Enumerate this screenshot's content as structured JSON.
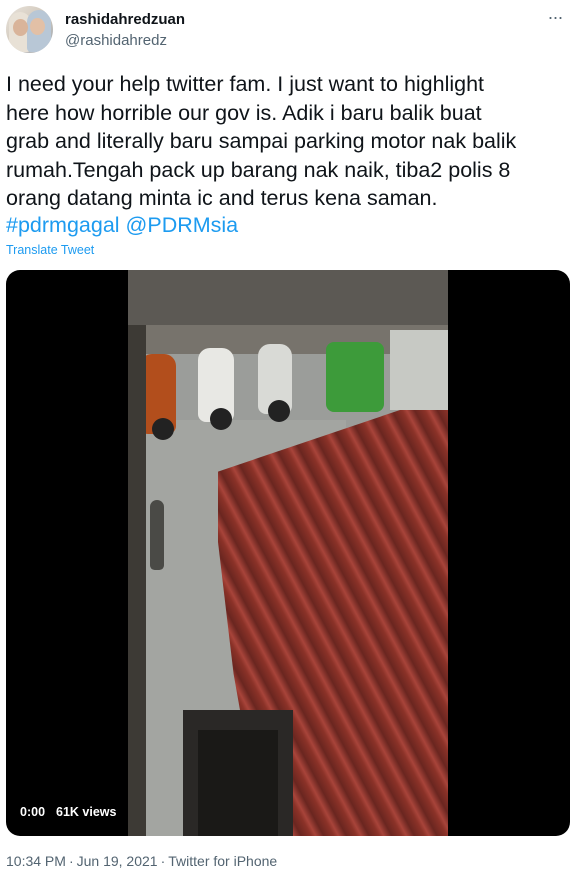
{
  "author": {
    "display_name": "rashidahredzuan",
    "handle": "@rashidahredz"
  },
  "more_menu_glyph": "···",
  "tweet": {
    "text": "I need your help twitter fam. I just want to highlight\nhere how horrible our gov is. Adik i baru balik buat\ngrab and literally baru sampai parking motor nak balik\nrumah.Tengah pack up barang nak naik, tiba2 polis 8\norang datang minta ic and terus kena saman.",
    "hashtag": "#pdrmgagal",
    "mention": "@PDRMsia",
    "translate_label": "Translate Tweet"
  },
  "video": {
    "time": "0:00",
    "views": "61K views"
  },
  "footer": {
    "time": "10:34 PM",
    "date": "Jun 19, 2021",
    "source": "Twitter for iPhone",
    "separator": "·"
  },
  "colors": {
    "link": "#1d9bf0",
    "text": "#0f1419",
    "secondary": "#536471"
  },
  "icons": {
    "more": "more-icon",
    "avatar": "avatar-image"
  }
}
